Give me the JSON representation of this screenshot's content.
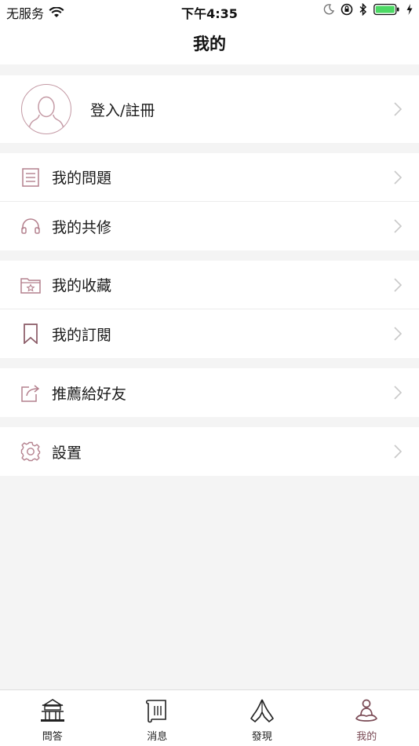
{
  "status_bar": {
    "carrier": "无服务",
    "time": "下午4:35"
  },
  "nav": {
    "title": "我的"
  },
  "profile": {
    "label": "登入/註冊"
  },
  "menu": {
    "questions": "我的問題",
    "cultivation": "我的共修",
    "favorites": "我的收藏",
    "subscriptions": "我的訂閱",
    "recommend": "推薦給好友",
    "settings": "設置"
  },
  "tabs": [
    {
      "label": "問答",
      "icon": "temple-icon"
    },
    {
      "label": "消息",
      "icon": "scroll-icon"
    },
    {
      "label": "發現",
      "icon": "praying-hands-icon"
    },
    {
      "label": "我的",
      "icon": "meditation-icon"
    }
  ],
  "colors": {
    "accent": "#b4818e",
    "active_tab": "#7a4a55",
    "background": "#f4f4f4"
  }
}
